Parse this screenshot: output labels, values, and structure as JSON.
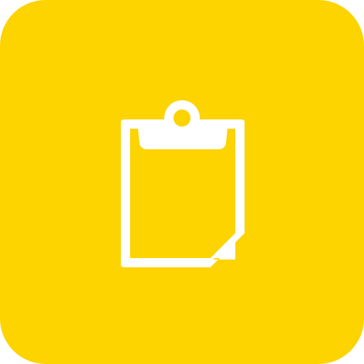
{
  "app_icon": {
    "icon": "clipboard-icon",
    "colors": {
      "background": "#FDD300",
      "glyph": "#FFFFFF"
    }
  }
}
